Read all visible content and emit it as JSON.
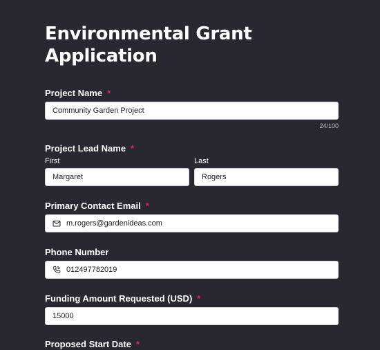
{
  "form": {
    "title": "Environmental Grant Application",
    "required_mark": "*",
    "project_name": {
      "label": "Project Name",
      "value": "Community Garden Project",
      "counter": "24/100"
    },
    "project_lead": {
      "label": "Project Lead Name",
      "first_label": "First",
      "first_value": "Margaret",
      "last_label": "Last",
      "last_value": "Rogers"
    },
    "email": {
      "label": "Primary Contact Email",
      "value": "m.rogers@gardenideas.com",
      "icon": "envelope-icon"
    },
    "phone": {
      "label": "Phone Number",
      "value": "012497782019",
      "icon": "phone-icon"
    },
    "funding": {
      "label": "Funding Amount Requested (USD)",
      "value": "15000"
    },
    "start_date": {
      "label": "Proposed Start Date"
    }
  },
  "colors": {
    "background": "#292831",
    "required": "#d6246e",
    "input_bg": "#ffffff"
  }
}
